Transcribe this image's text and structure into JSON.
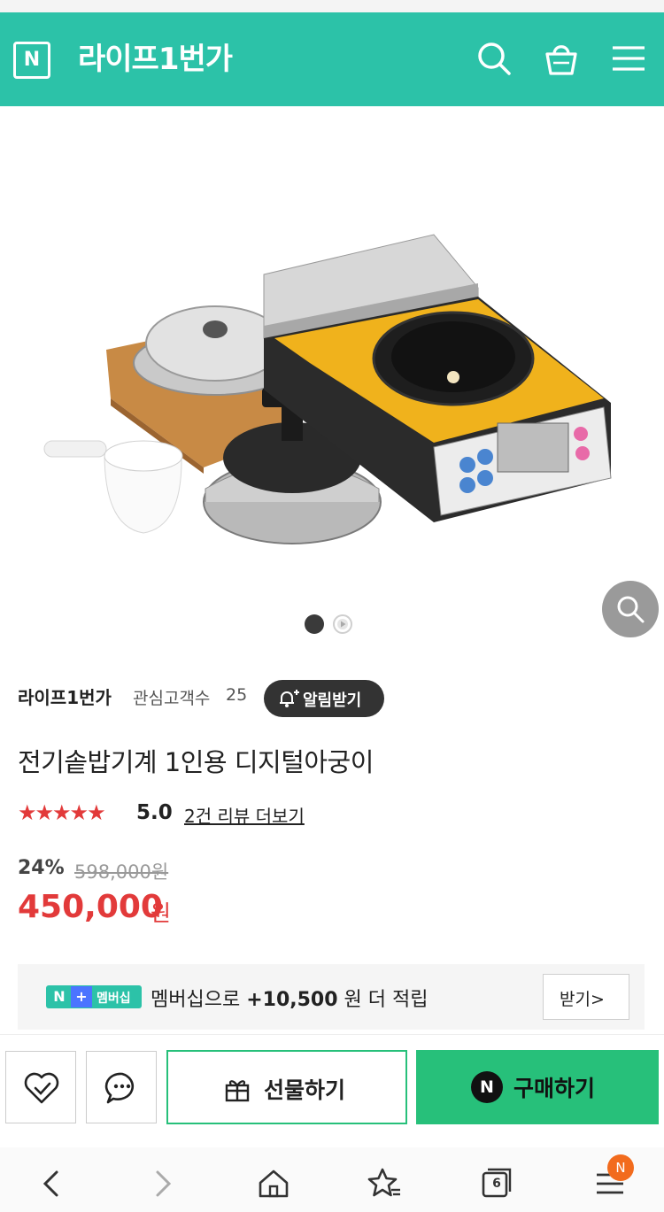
{
  "header": {
    "logo_letter": "N",
    "store_title": "라이프1번가",
    "brand_color": "#2cc2a8",
    "icons": [
      "search-icon",
      "shopping-bag-icon",
      "menu-icon"
    ]
  },
  "gallery": {
    "image_description": "전기솥밥기계 product photo",
    "total_slides": 2,
    "active_slide": 1,
    "zoom_icon": "magnifier-icon"
  },
  "seller": {
    "name": "라이프1번가",
    "favorite_label": "관심고객수",
    "favorite_count": "25",
    "alert_button": "알림받기"
  },
  "product": {
    "name": "전기솥밥기계 1인용 디지털아궁이",
    "stars": "★★★★★",
    "rating": "5.0",
    "review_link": "2건 리뷰 더보기",
    "discount_rate": "24%",
    "original_price": "598,000원",
    "sale_price": "450,000",
    "sale_currency": "원",
    "price_color": "#e23a3a"
  },
  "membership": {
    "badge_n": "N",
    "badge_plus": "+",
    "badge_text": "멤버십",
    "prefix": "멤버십으로",
    "amount": "+10,500",
    "suffix": "원 더 적립",
    "receive_button": "받기>"
  },
  "actions": {
    "wish_icon": "heart-check-icon",
    "chat_icon": "chat-bubble-icon",
    "gift_label": "선물하기",
    "buy_badge": "N",
    "buy_label": "구매하기",
    "buy_color": "#27c07a"
  },
  "navbar": {
    "tab_count": "6",
    "menu_badge": "N"
  }
}
